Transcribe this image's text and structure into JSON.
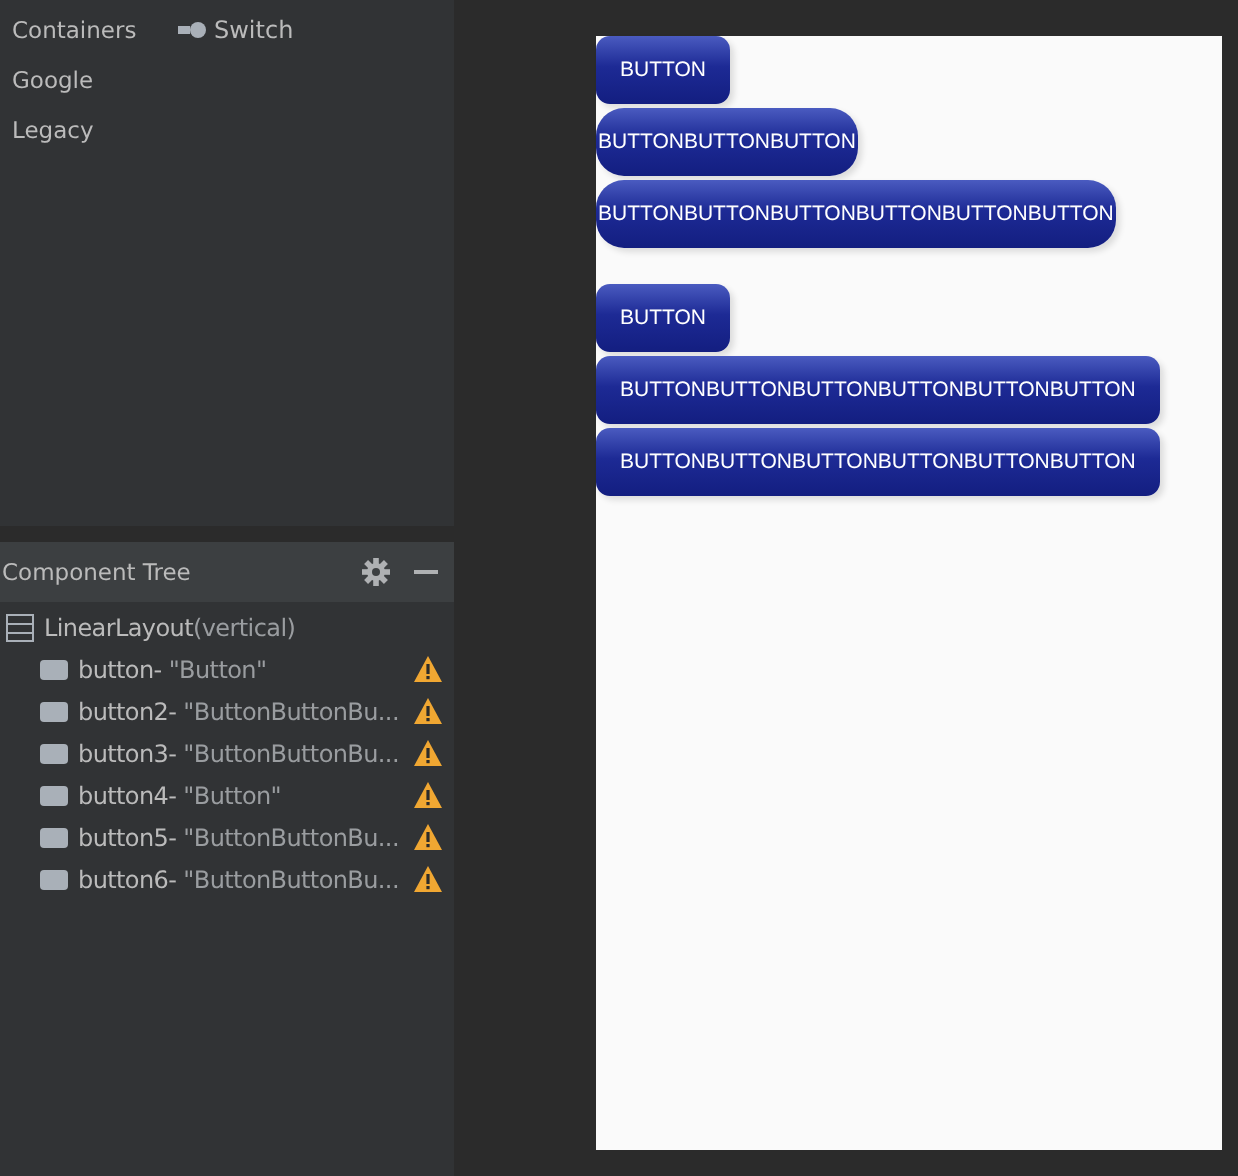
{
  "palette": {
    "categories": [
      "Containers",
      "Google",
      "Legacy"
    ],
    "items": [
      "Switch"
    ]
  },
  "component_tree": {
    "title": "Component Tree",
    "root": {
      "label": "LinearLayout",
      "detail": "(vertical)",
      "children": [
        {
          "id_text": "button-",
          "text": "\"Button\"",
          "warning": true
        },
        {
          "id_text": "button2-",
          "text": "\"ButtonButtonBu...",
          "warning": true
        },
        {
          "id_text": "button3-",
          "text": "\"ButtonButtonBu...",
          "warning": true
        },
        {
          "id_text": "button4-",
          "text": "\"Button\"",
          "warning": true
        },
        {
          "id_text": "button5-",
          "text": "\"ButtonButtonBu...",
          "warning": true
        },
        {
          "id_text": "button6-",
          "text": "\"ButtonButtonBu...",
          "warning": true
        }
      ]
    }
  },
  "preview": {
    "buttons": [
      {
        "label": "BUTTON",
        "kind": "padded"
      },
      {
        "label": "BUTTONBUTTONBUTTON",
        "kind": "tight"
      },
      {
        "label": "BUTTONBUTTONBUTTONBUTTONBUTTONBUTTON",
        "kind": "tight"
      },
      {
        "label": "BUTTON",
        "kind": "padded"
      },
      {
        "label": "BUTTONBUTTONBUTTONBUTTONBUTTONBUTTON",
        "kind": "padded"
      },
      {
        "label": "BUTTONBUTTONBUTTONBUTTONBUTTONBUTTON",
        "kind": "padded"
      }
    ]
  }
}
